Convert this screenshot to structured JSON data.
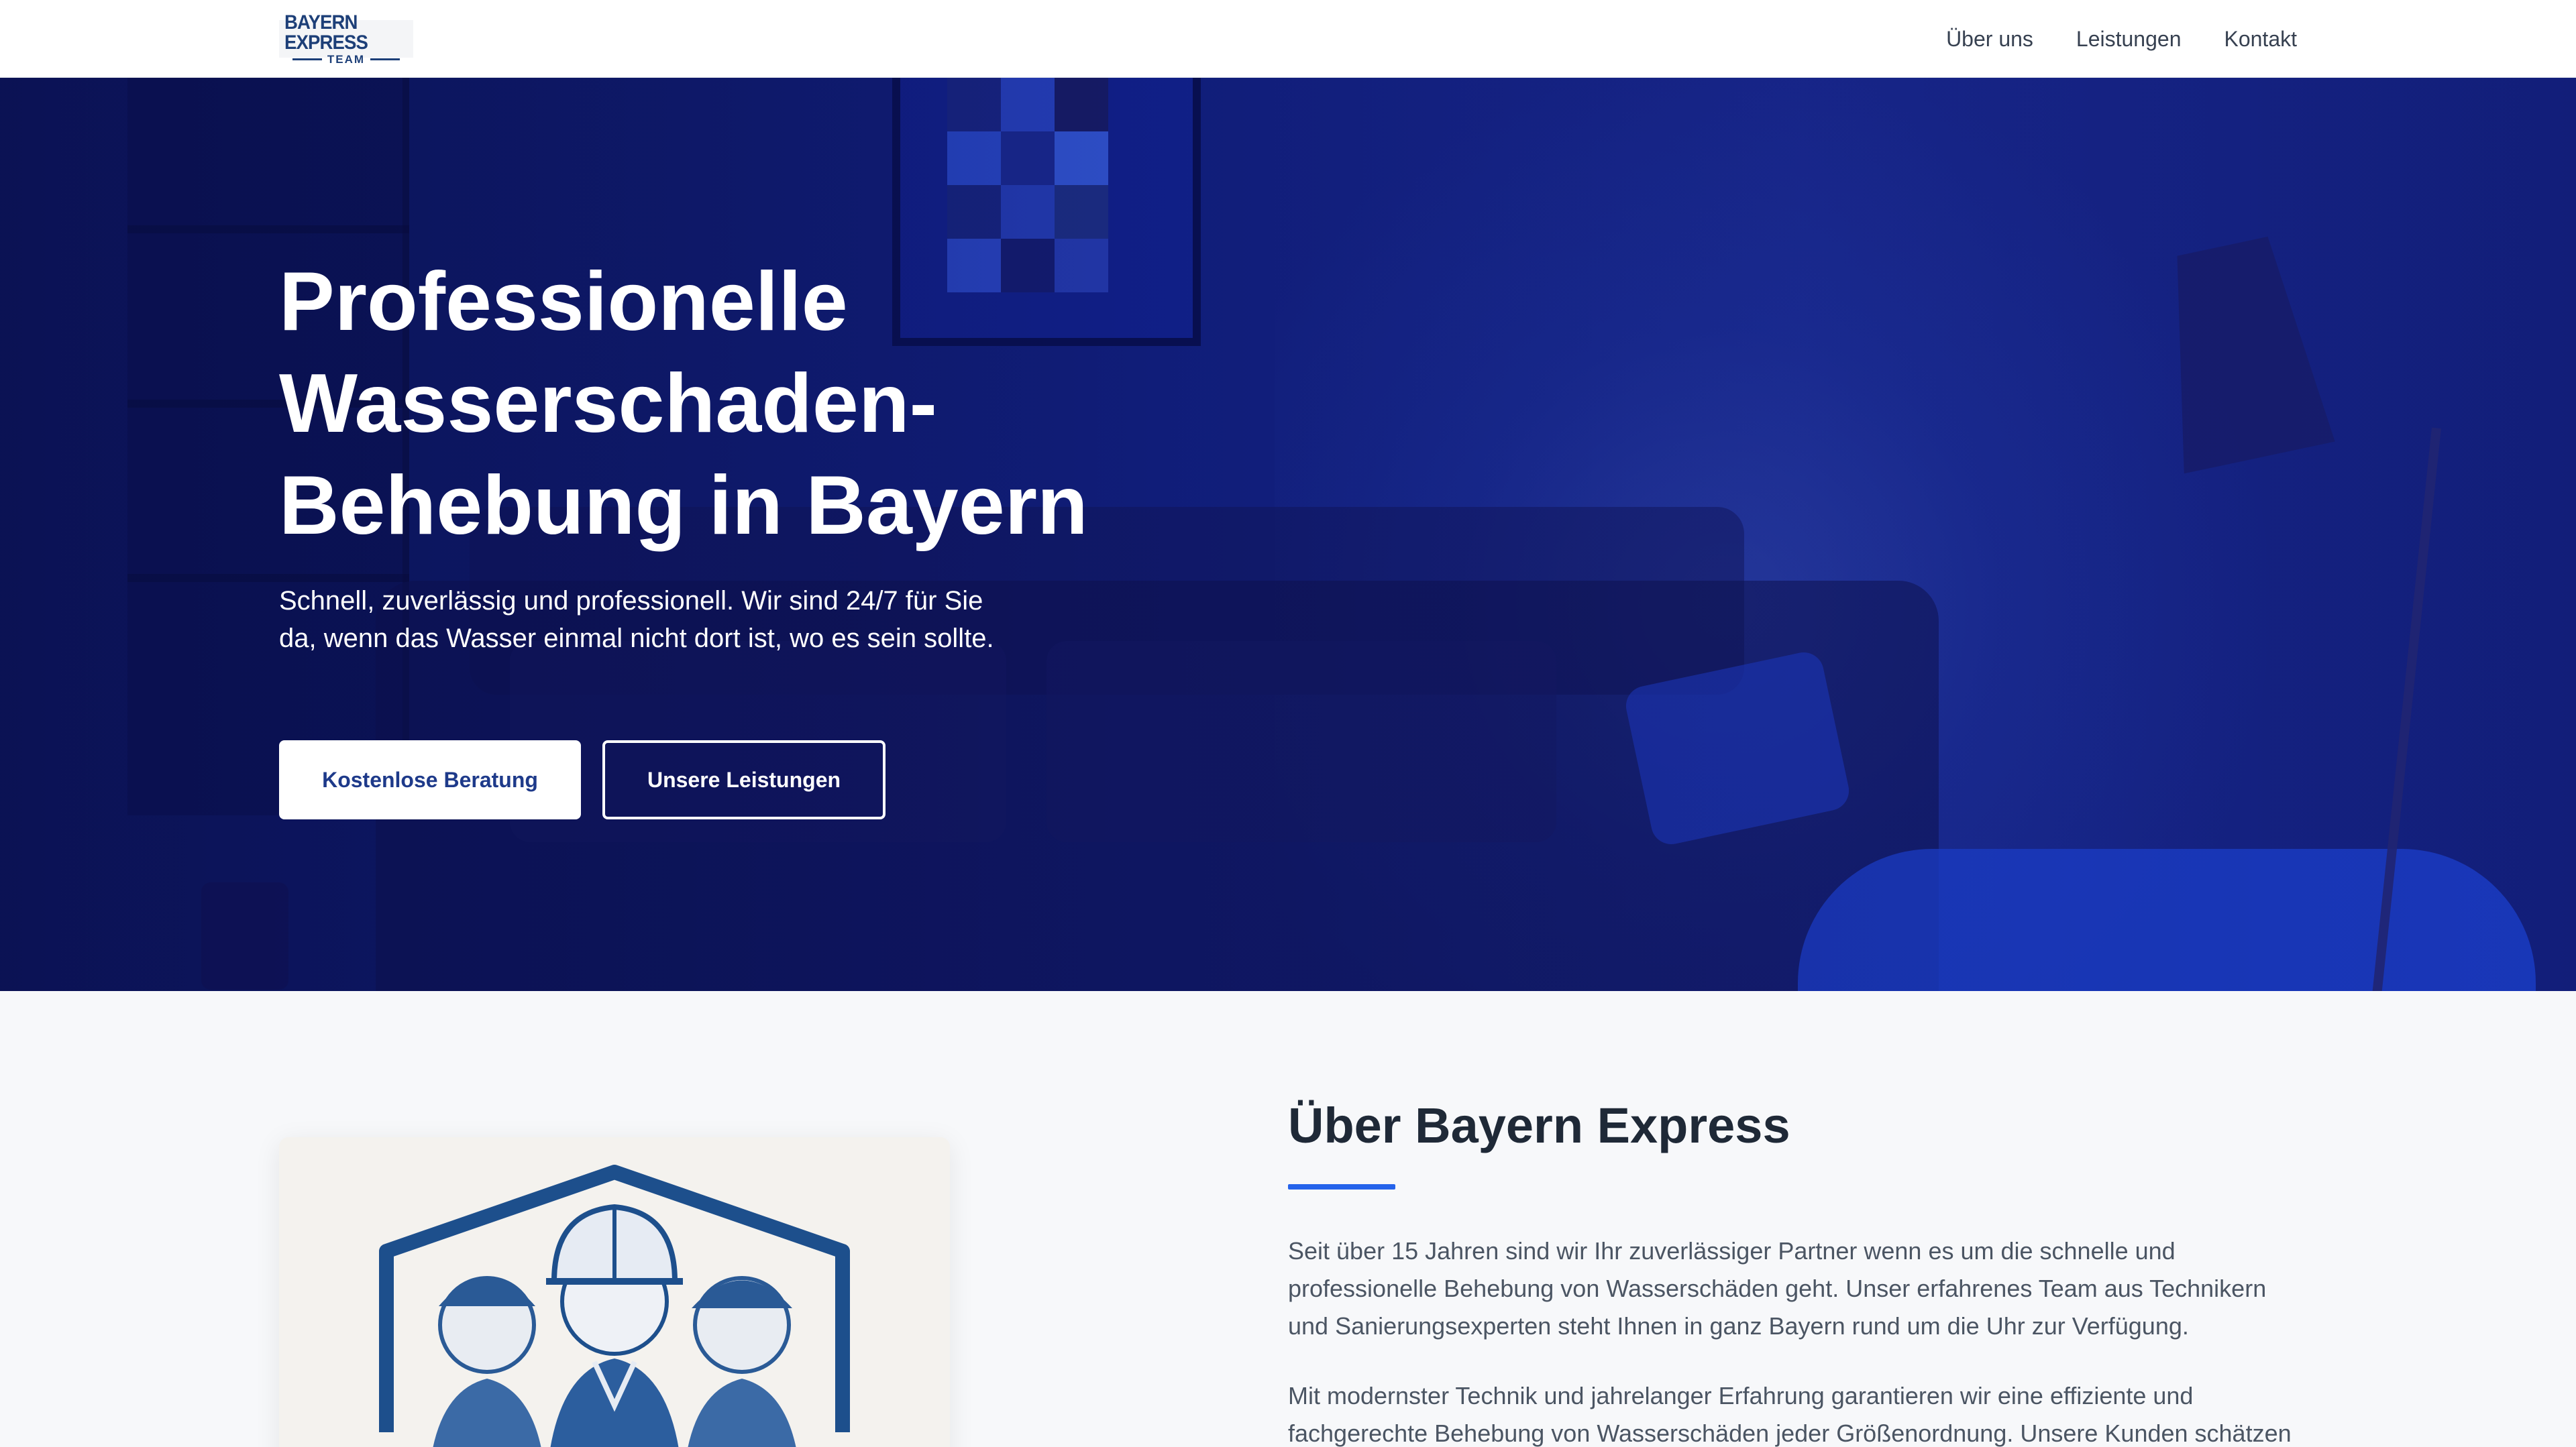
{
  "header": {
    "logo": {
      "main": "BAYERN EXPRESS",
      "sub": "TEAM"
    },
    "nav": [
      "Über uns",
      "Leistungen",
      "Kontakt"
    ]
  },
  "hero": {
    "title_lines": [
      "Professionelle",
      "Wasserschaden-",
      "Behebung in Bayern"
    ],
    "subtitle": "Schnell, zuverlässig und professionell. Wir sind 24/7 für Sie da, wenn das Wasser einmal nicht dort ist, wo es sein sollte.",
    "primary_button": "Kostenlose Beratung",
    "secondary_button": "Unsere Leistungen"
  },
  "about": {
    "title": "Über Bayern Express",
    "paragraph1": "Seit über 15 Jahren sind wir Ihr zuverlässiger Partner wenn es um die schnelle und professionelle Behebung von Wasserschäden geht. Unser erfahrenes Team aus Technikern und Sanierungsexperten steht Ihnen in ganz Bayern rund um die Uhr zur Verfügung.",
    "paragraph2": "Mit modernster Technik und jahrelanger Erfahrung garantieren wir eine effiziente und fachgerechte Behebung von Wasserschäden jeder Größenordnung. Unsere Kunden schätzen"
  },
  "colors": {
    "brand": "#1d3f78",
    "accent": "#2563eb",
    "hero_bg": "#13238a"
  }
}
